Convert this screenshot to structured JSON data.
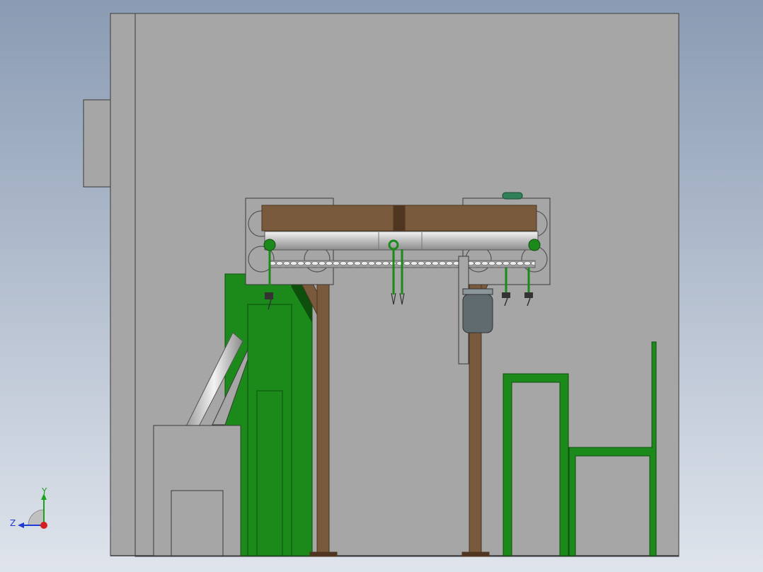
{
  "viewport": {
    "background_top": "#8a9bb3",
    "background_bottom": "#dfe4ec"
  },
  "colors": {
    "cabinet": "#a6a6a6",
    "cabinet_edge": "#3a3a3a",
    "frame_wood": "#7a5a3c",
    "frame_wood_dark": "#4e3621",
    "machine_green": "#1b8a1b",
    "machine_green_dark": "#0d4f0d",
    "steel": "#c8c8c8",
    "chain": "#e0e0e0",
    "motor": "#5f6b6f",
    "triad_x": "#d31f1f",
    "triad_y": "#19a319",
    "triad_z": "#1f3bd3"
  },
  "triad": {
    "y_label": "Y",
    "z_label": "Z"
  },
  "icons": {
    "view_triad": "coordinate-triad-icon"
  }
}
